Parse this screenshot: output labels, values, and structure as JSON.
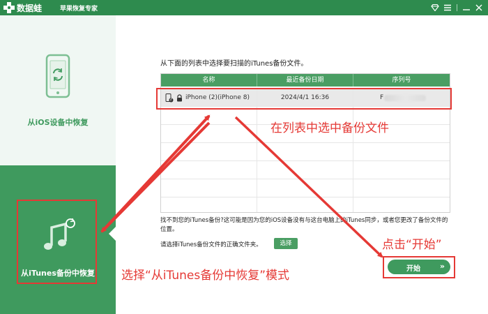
{
  "titlebar": {
    "app_name": "数据蛙",
    "subtitle": "苹果恢复专家",
    "icons": [
      "diamond-icon",
      "menu-icon",
      "minimize-icon",
      "close-icon"
    ]
  },
  "sidebar": {
    "ios_label": "从iOS设备中恢复",
    "itunes_label": "从iTunes备份中恢复"
  },
  "main": {
    "instruction": "从下面的列表中选择要扫描的iTunes备份文件。",
    "table": {
      "headers": [
        "名称",
        "最近备份日期",
        "序列号"
      ],
      "rows": [
        {
          "name": "iPhone (2)(iPhone 8)",
          "date": "2024/4/1 16:36",
          "serial": "F"
        }
      ]
    },
    "help_text": "找不到您的iTunes备份?这可能是因为您的iOS设备没有与这台电脑上的iTunes同步，或者您更改了备份文件的位置。",
    "folder_label": "请选择iTunes备份文件的正确文件夹。",
    "select_button": "选择",
    "start_button": "开始",
    "start_chevron": "»"
  },
  "annotations": {
    "select_in_list": "在列表中选中备份文件",
    "click_start": "点击“开始”",
    "choose_mode": "选择“从iTunes备份中恢复”模式"
  },
  "colors": {
    "brand_green": "#3f9a5e",
    "header_green": "#4a9e63",
    "annotation_red": "#e53935"
  }
}
